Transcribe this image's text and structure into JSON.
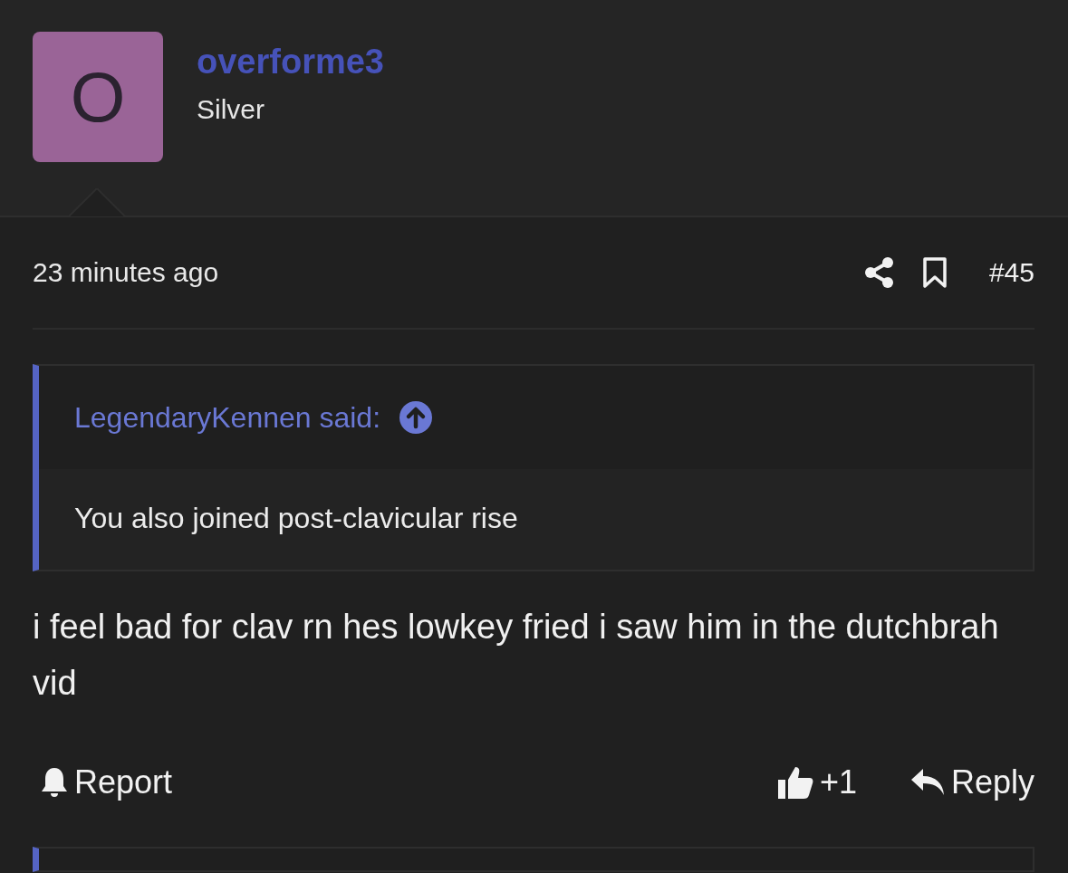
{
  "author": {
    "avatar_letter": "O",
    "name": "overforme3",
    "rank": "Silver"
  },
  "meta": {
    "time": "23 minutes ago",
    "post_number": "#45"
  },
  "quote": {
    "author": "LegendaryKennen said:",
    "text": "You also joined post-clavicular rise"
  },
  "body": "i feel bad for clav rn hes lowkey fried i saw him in the dutchbrah vid",
  "actions": {
    "report": "Report",
    "likes": "+1",
    "reply": "Reply"
  }
}
